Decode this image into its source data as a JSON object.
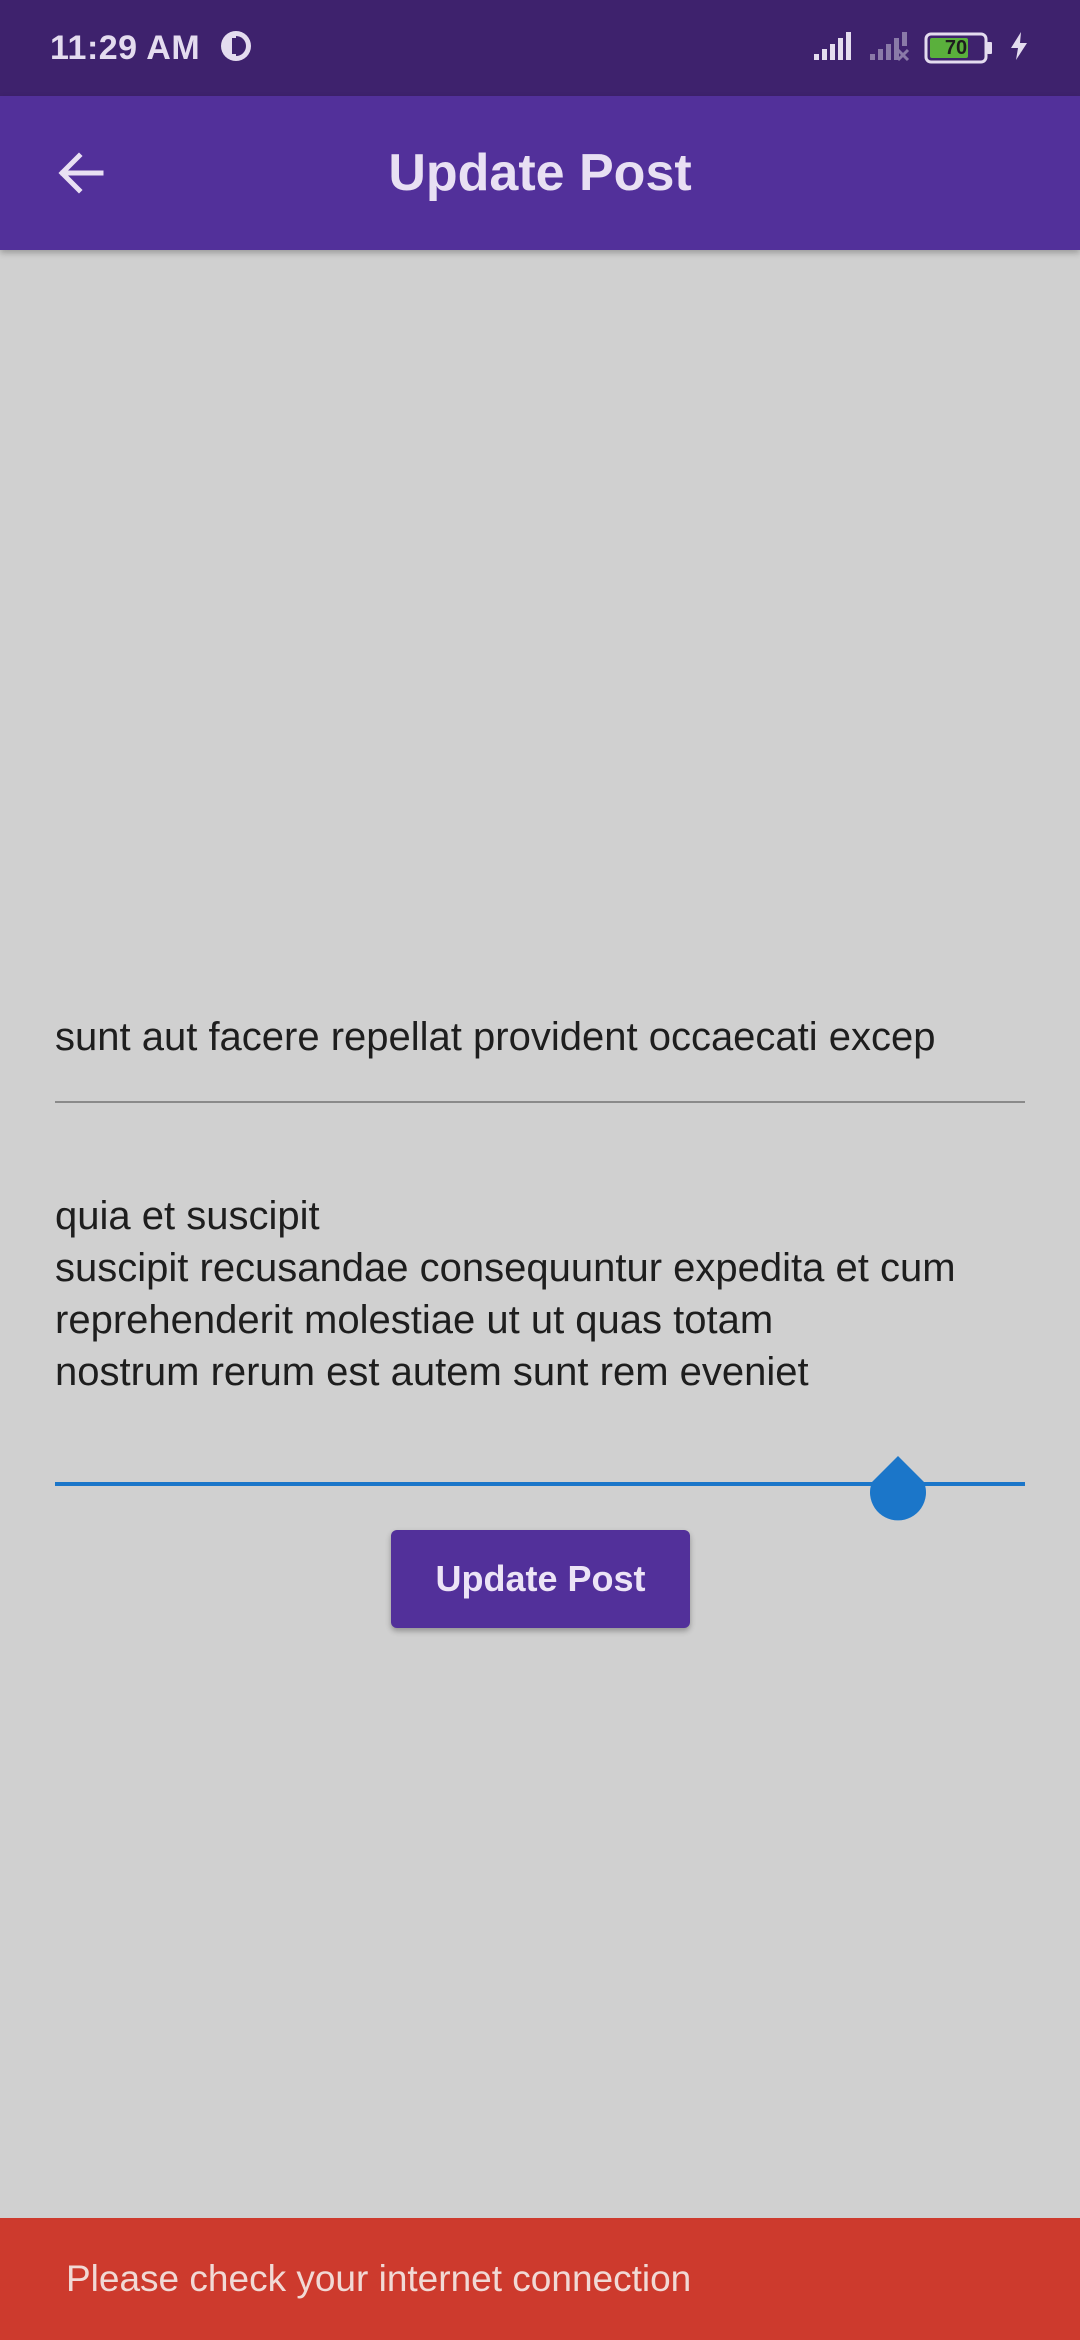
{
  "status_bar": {
    "time": "11:29 AM",
    "battery_level": "70",
    "icons": [
      "data-saver-icon",
      "signal-icon",
      "no-signal-icon",
      "battery-icon",
      "charging-icon"
    ]
  },
  "app_bar": {
    "title": "Update Post",
    "back_icon": "arrow-left-icon"
  },
  "form": {
    "title_value": "sunt aut facere repellat provident occaecati excep",
    "body_value": "quia et suscipit\nsuscipit recusandae consequuntur expedita et cum\nreprehenderit molestiae ut ut quas totam\nnostrum rerum est autem sunt rem eveniet",
    "submit_label": "Update Post"
  },
  "snackbar": {
    "message": "Please check your internet connection"
  },
  "colors": {
    "status_bar": "#3e226d",
    "app_bar": "#52309a",
    "background": "#d0d0d0",
    "focus_accent": "#1b76c9",
    "snackbar": "#cd3a2d"
  }
}
